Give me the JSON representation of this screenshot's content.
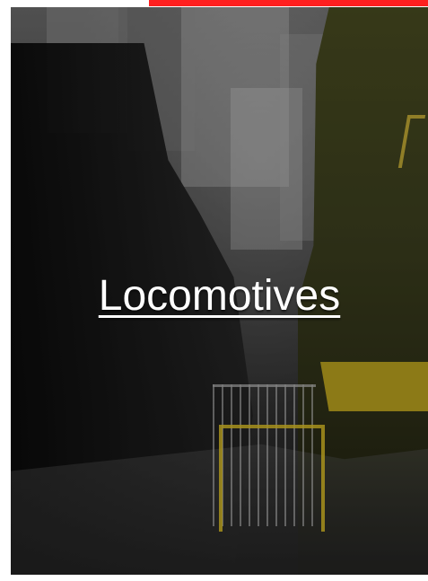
{
  "tile": {
    "title": "Locomotives"
  },
  "colors": {
    "accent_red": "#ff1f1f"
  }
}
